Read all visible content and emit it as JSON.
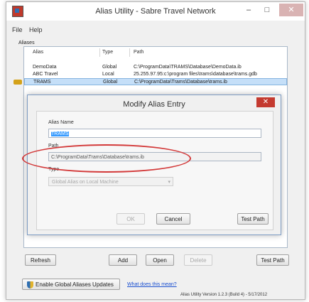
{
  "window": {
    "title": "Alias Utility - Sabre Travel Network",
    "min_glyph": "–",
    "max_glyph": "□",
    "close_glyph": "✕"
  },
  "menu": {
    "file": "File",
    "help": "Help"
  },
  "aliases": {
    "group_label": "Aliases",
    "columns": {
      "alias": "Alias",
      "type": "Type",
      "path": "Path"
    },
    "rows": [
      {
        "alias": "DemoData",
        "type": "Global",
        "path": "C:\\ProgramData\\TRAMS\\Database\\DemoData.ib"
      },
      {
        "alias": "ABC Travel",
        "type": "Local",
        "path": "25.255.97.95:c:\\program files\\trams\\database\\trams.gdb"
      },
      {
        "alias": "TRAMS",
        "type": "Global",
        "path": "C:\\ProgramData\\Trams\\Database\\trams.ib",
        "selected": true
      }
    ]
  },
  "dialog": {
    "title": "Modify Alias Entry",
    "close_glyph": "✕",
    "alias_name_label": "Alias Name",
    "alias_name_value": "TRAMS",
    "path_label": "Path",
    "path_value": "C:\\ProgramData\\Trams\\Database\\trams.ib",
    "type_label": "Type",
    "type_value": "Global Alias on Local Machine",
    "ok_label": "OK",
    "cancel_label": "Cancel",
    "test_path_label": "Test Path"
  },
  "toolbar": {
    "refresh": "Refresh",
    "add": "Add",
    "open": "Open",
    "delete": "Delete",
    "test_path": "Test Path"
  },
  "footer": {
    "enable_global": "Enable Global Aliases Updates",
    "what_link": "What does this mean?",
    "version": "Alias Utility Version 1.2.3 (Build 4) - 5/17/2012"
  },
  "colors": {
    "accent_selection": "#c5dff8",
    "highlight_ellipse": "#d33a3a",
    "close_red": "#c43a30"
  },
  "icons": {
    "app": "app-icon",
    "key": "key-icon",
    "shield": "shield-icon"
  }
}
